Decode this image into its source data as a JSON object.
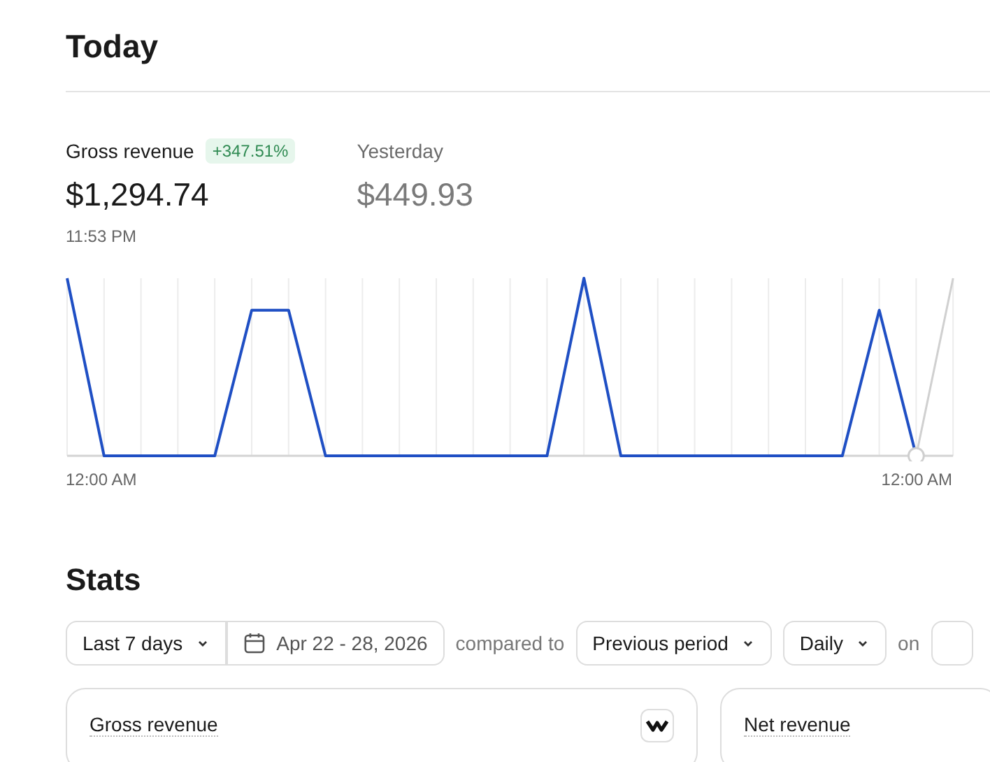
{
  "page_title": "Today",
  "today": {
    "label": "Gross revenue",
    "change": "+347.51%",
    "value": "$1,294.74",
    "time": "11:53 PM"
  },
  "yesterday": {
    "label": "Yesterday",
    "value": "$449.93"
  },
  "chart": {
    "x_start_label": "12:00 AM",
    "x_end_label": "12:00 AM"
  },
  "stats": {
    "title": "Stats",
    "filters": [
      {
        "kind": "select",
        "label": "Last 7 days"
      },
      {
        "kind": "date",
        "label": "Apr 22 - 28, 2026"
      },
      {
        "kind": "text",
        "label": "compared to"
      },
      {
        "kind": "select",
        "label": "Previous period"
      },
      {
        "kind": "select",
        "label": "Daily"
      },
      {
        "kind": "text",
        "label": "on"
      },
      {
        "kind": "cut"
      }
    ],
    "cards": [
      {
        "title": "Gross revenue",
        "has_icon": true
      },
      {
        "title": "Net revenue",
        "has_icon": false
      }
    ]
  }
}
